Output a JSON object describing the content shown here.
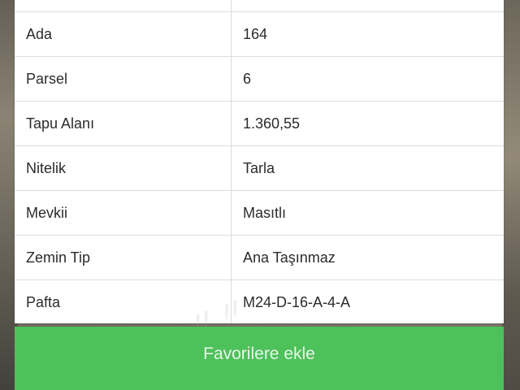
{
  "property_details": {
    "rows": [
      {
        "label": "Ada",
        "value": "164"
      },
      {
        "label": "Parsel",
        "value": "6"
      },
      {
        "label": "Tapu Alanı",
        "value": "1.360,55"
      },
      {
        "label": "Nitelik",
        "value": "Tarla"
      },
      {
        "label": "Mevkii",
        "value": "Masıtlı"
      },
      {
        "label": "Zemin Tip",
        "value": "Ana Taşınmaz"
      },
      {
        "label": "Pafta",
        "value": "M24-D-16-A-4-A"
      }
    ]
  },
  "actions": {
    "favorite_label": "Favorilere ekle",
    "favorite_color": "#4dc15a"
  }
}
